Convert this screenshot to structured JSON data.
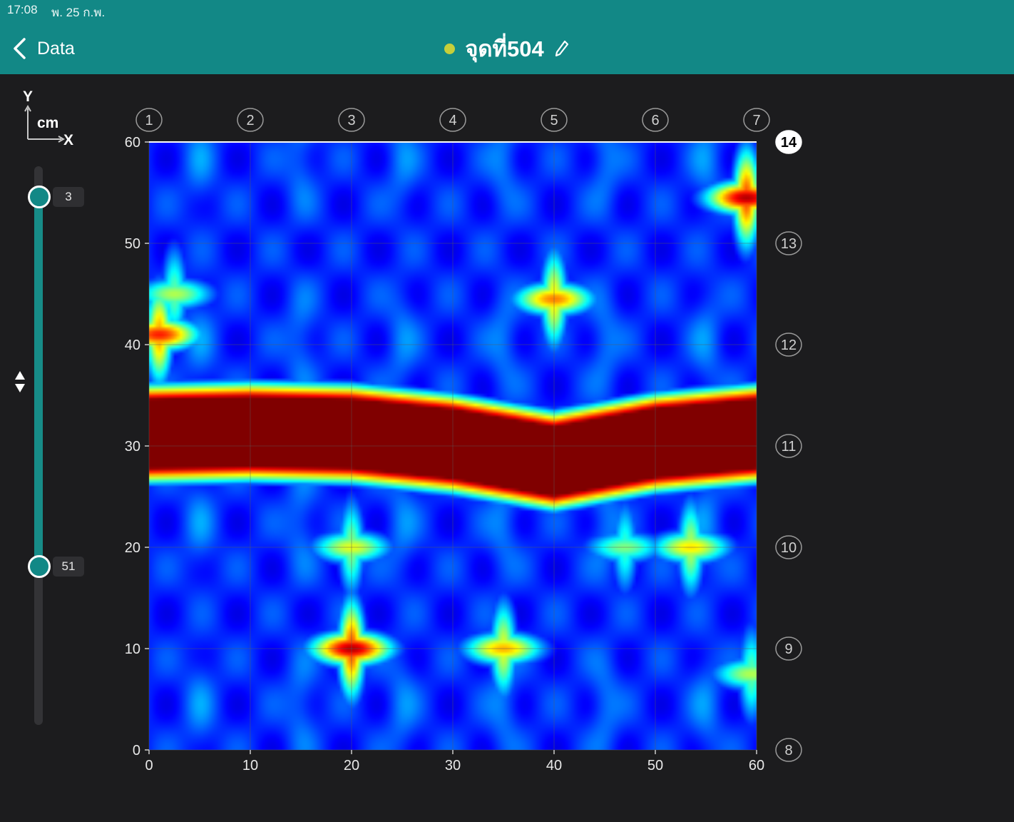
{
  "status_bar": {
    "time": "17:08",
    "date": "พ. 25 ก.พ."
  },
  "header": {
    "back_label": "Data",
    "title": "จุดที่504",
    "status_color": "#c6cf3a",
    "bar_color": "#128886",
    "back_icon": "chevron-left-icon",
    "edit_icon": "pencil-icon"
  },
  "axis_legend": {
    "y": "Y",
    "unit": "cm",
    "x": "X"
  },
  "depth_slider": {
    "min_label": "3",
    "max_label": "51",
    "min_value": 3,
    "max_value": 51,
    "range_min": 0,
    "range_max": 60
  },
  "chart_data": {
    "type": "heatmap",
    "colormap": "jet",
    "xlim": [
      0,
      60
    ],
    "ylim": [
      0,
      60
    ],
    "x_ticks": [
      "0",
      "10",
      "20",
      "30",
      "40",
      "50",
      "60"
    ],
    "y_ticks": [
      "0",
      "10",
      "20",
      "30",
      "40",
      "50",
      "60"
    ],
    "grid": true,
    "top_line_labels": [
      "1",
      "2",
      "3",
      "4",
      "5",
      "6",
      "7"
    ],
    "right_line_labels": [
      "8",
      "9",
      "10",
      "11",
      "12",
      "13",
      "14"
    ],
    "active_right_label": "14",
    "hot_band": {
      "y_center": [
        31.2,
        31.4,
        31.2,
        30.2,
        28.5,
        30.3,
        31.2
      ],
      "half_width": 3.4
    },
    "hot_spots": [
      {
        "x": 20,
        "y": 10,
        "value": 0.95
      },
      {
        "x": 59,
        "y": 54.5,
        "value": 0.95
      },
      {
        "x": 40,
        "y": 44.5,
        "value": 0.75
      },
      {
        "x": 1,
        "y": 41,
        "value": 0.85
      },
      {
        "x": 35,
        "y": 10,
        "value": 0.7
      },
      {
        "x": 53.5,
        "y": 20,
        "value": 0.65
      },
      {
        "x": 20,
        "y": 20,
        "value": 0.6
      },
      {
        "x": 2.5,
        "y": 45,
        "value": 0.55
      },
      {
        "x": 59.5,
        "y": 7.5,
        "value": 0.55
      },
      {
        "x": 47,
        "y": 20,
        "value": 0.5
      }
    ]
  }
}
